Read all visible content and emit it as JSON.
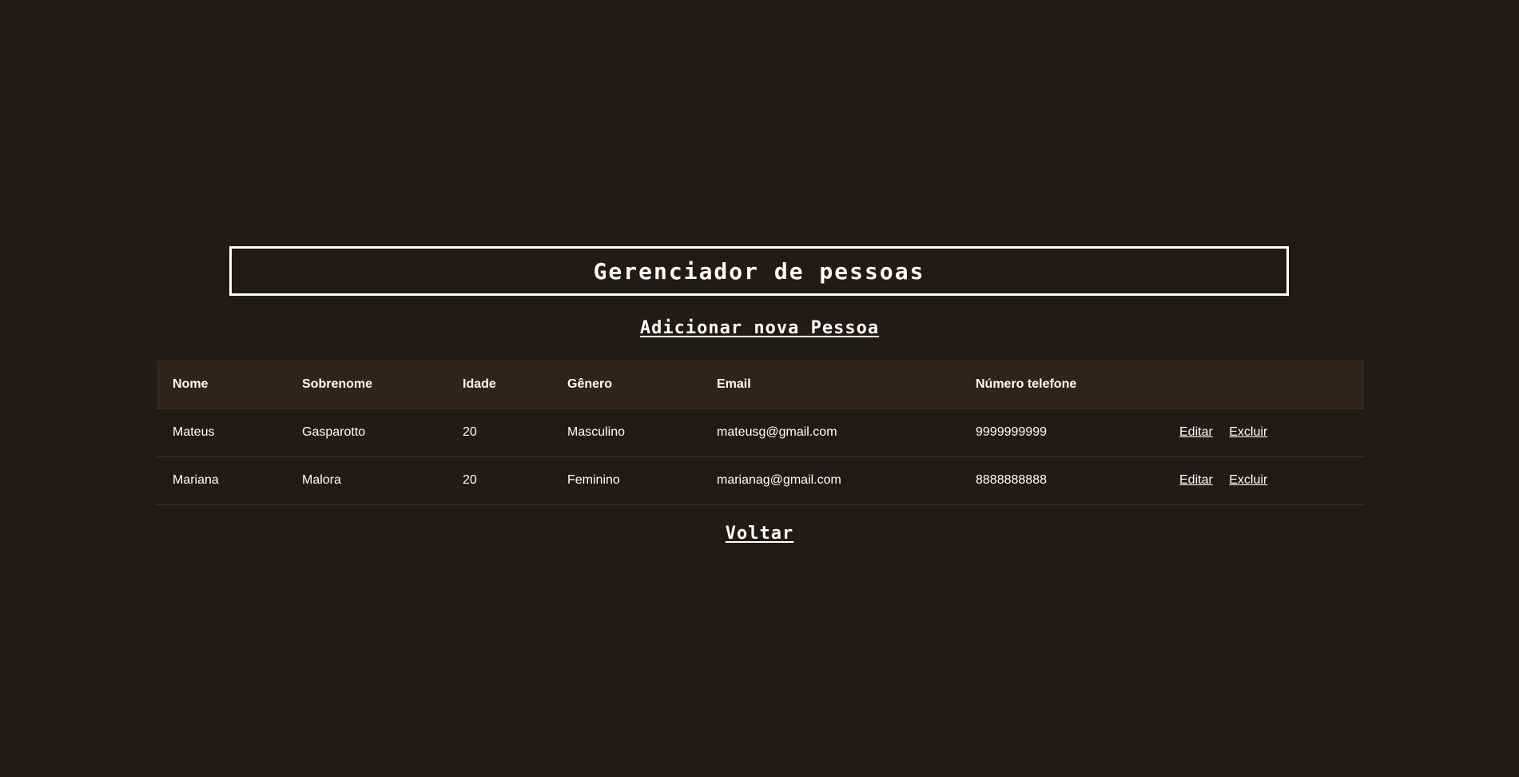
{
  "header": {
    "title": "Gerenciador de pessoas"
  },
  "add_link": "Adicionar nova Pessoa",
  "table": {
    "columns": [
      "Nome",
      "Sobrenome",
      "Idade",
      "Gênero",
      "Email",
      "Número telefone",
      ""
    ],
    "rows": [
      {
        "nome": "Mateus",
        "sobrenome": "Gasparotto",
        "idade": "20",
        "genero": "Masculino",
        "email": "mateusg@gmail.com",
        "telefone": "9999999999",
        "edit_label": "Editar",
        "delete_label": "Excluir"
      },
      {
        "nome": "Mariana",
        "sobrenome": "Malora",
        "idade": "20",
        "genero": "Feminino",
        "email": "marianag@gmail.com",
        "telefone": "8888888888",
        "edit_label": "Editar",
        "delete_label": "Excluir"
      }
    ]
  },
  "back_link": "Voltar",
  "colors": {
    "background": "#201b16",
    "table_header_bg": "#2e241c",
    "text": "#ffffff",
    "row_divider": "#3a322b"
  }
}
